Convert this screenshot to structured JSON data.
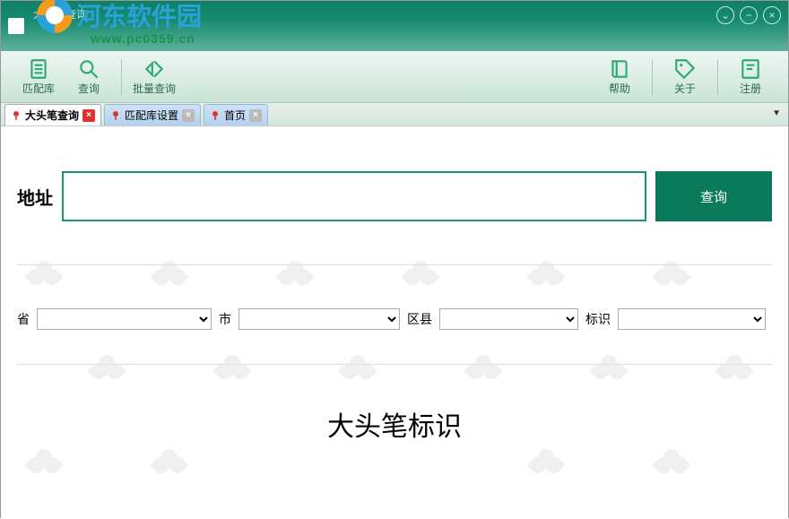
{
  "window": {
    "title": "大头笔查询"
  },
  "watermark": {
    "text": "河东软件园",
    "url": "www.pc0359.cn"
  },
  "toolbar": {
    "match_db": "匹配库",
    "query": "查询",
    "batch_query": "批量查询",
    "help": "帮助",
    "about": "关于",
    "register": "注册"
  },
  "tabs": [
    {
      "label": "大头笔查询",
      "active": true,
      "close_style": "red"
    },
    {
      "label": "匹配库设置",
      "active": false,
      "close_style": "gray"
    },
    {
      "label": "首页",
      "active": false,
      "close_style": "gray"
    }
  ],
  "main": {
    "address_label": "地址",
    "address_value": "",
    "search_button": "查询",
    "filters": {
      "province_label": "省",
      "city_label": "市",
      "district_label": "区县",
      "tag_label": "标识"
    },
    "heading": "大头笔标识"
  }
}
